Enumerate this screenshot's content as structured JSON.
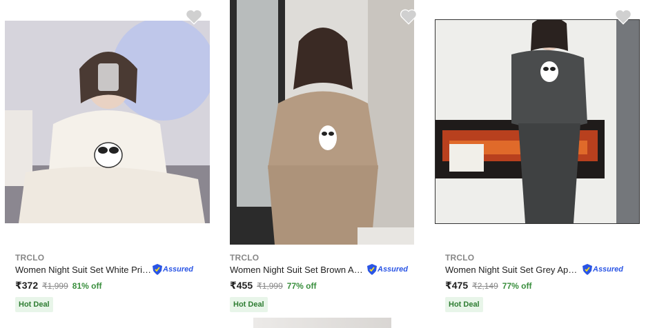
{
  "products": [
    {
      "brand": "TRCLO",
      "title": "Women Night Suit Set White Prin...",
      "assured": "Assured",
      "price": "₹372",
      "mrp": "₹1,999",
      "discount": "81% off",
      "deal_badge": "Hot Deal",
      "image": "white fleece night suit photo"
    },
    {
      "brand": "TRCLO",
      "title": "Women Night Suit Set Brown Ap...",
      "assured": "Assured",
      "price": "₹455",
      "mrp": "₹1,999",
      "discount": "77% off",
      "deal_badge": "Hot Deal",
      "image": "brown fleece night suit photo"
    },
    {
      "brand": "TRCLO",
      "title": "Women Night Suit Set Grey Appli...",
      "assured": "Assured",
      "price": "₹475",
      "mrp": "₹2,149",
      "discount": "77% off",
      "deal_badge": "Hot Deal",
      "image": "grey fleece night suit photo"
    }
  ],
  "colors": {
    "discount_green": "#388e3c",
    "assured_blue": "#2a55e5",
    "deal_bg": "#e8f5e9"
  }
}
